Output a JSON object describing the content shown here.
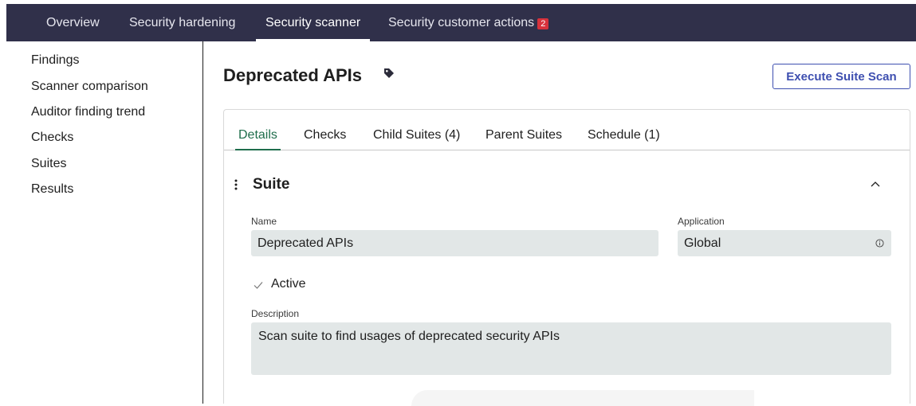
{
  "topnav": {
    "tabs": [
      {
        "label": "Overview"
      },
      {
        "label": "Security hardening"
      },
      {
        "label": "Security scanner",
        "active": true
      },
      {
        "label": "Security customer actions",
        "badge": "2"
      }
    ],
    "background": "#30304a"
  },
  "sidebar": {
    "items": [
      {
        "label": "Findings"
      },
      {
        "label": "Scanner comparison"
      },
      {
        "label": "Auditor finding trend"
      },
      {
        "label": "Checks"
      },
      {
        "label": "Suites"
      },
      {
        "label": "Results"
      }
    ]
  },
  "main": {
    "title": "Deprecated APIs",
    "title_icon": "tag-icon",
    "execute_button": "Execute Suite Scan",
    "tabs": [
      {
        "label": "Details",
        "active": true
      },
      {
        "label": "Checks"
      },
      {
        "label": "Child Suites (4)"
      },
      {
        "label": "Parent Suites"
      },
      {
        "label": "Schedule (1)"
      }
    ],
    "section": {
      "title": "Suite",
      "name_label": "Name",
      "name_value": "Deprecated APIs",
      "application_label": "Application",
      "application_value": "Global",
      "active_label": "Active",
      "active_checked": true,
      "description_label": "Description",
      "description_value": "Scan suite to find usages of deprecated security APIs"
    }
  },
  "colors": {
    "accent_green": "#1f6e4c",
    "button_blue": "#3e4fb0",
    "badge_red": "#d8323c",
    "field_bg": "#e2e7e7"
  }
}
